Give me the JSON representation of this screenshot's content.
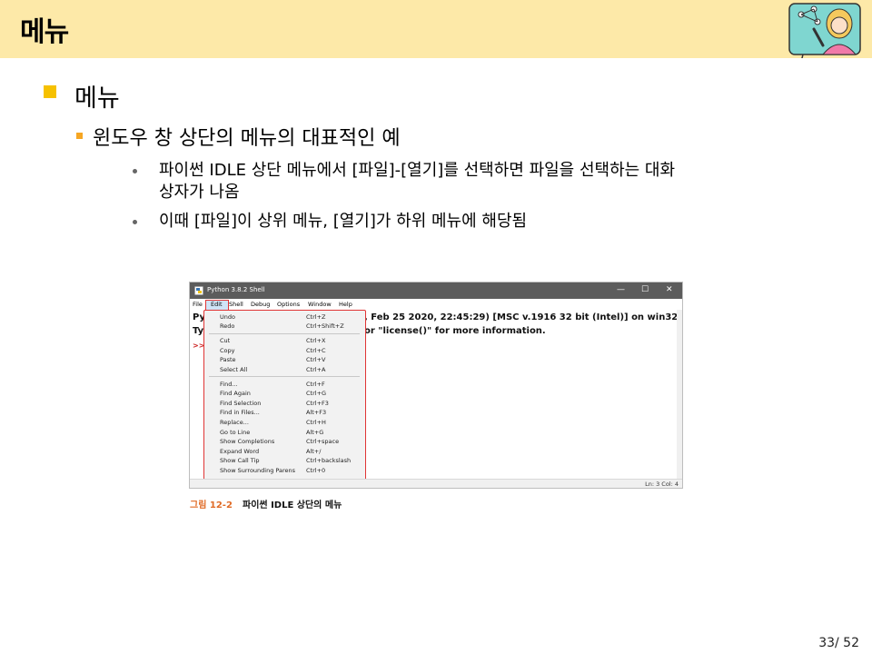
{
  "slide": {
    "title": "메뉴",
    "heading": "메뉴",
    "subheading": "윈도우 창 상단의 메뉴의 대표적인 예",
    "bullets": [
      {
        "line1": "파이썬 IDLE 상단 메뉴에서 [파일]-[열기]를 선택하면 파일을 선택하는 대화",
        "line2": "상자가 나옴"
      },
      {
        "line1": "이때 [파일]이 상위 메뉴, [열기]가 하위 메뉴에 해당됨"
      }
    ],
    "caption_number": "그림 12-2",
    "caption_text": "파이썬 IDLE 상단의 메뉴",
    "page": "33/ 52"
  },
  "window": {
    "title": "Python 3.8.2 Shell",
    "controls": {
      "minimize": "—",
      "maximize": "☐",
      "close": "✕"
    },
    "menubar": [
      "File",
      "Edit",
      "Shell",
      "Debug",
      "Options",
      "Window",
      "Help"
    ],
    "shell_line1_start": "Pyt",
    "shell_line1_end": ", Feb 25 2020, 22:45:29) [MSC v.1916 32 bit (Intel)] on win32",
    "shell_line2_start": "Typ",
    "shell_line2_end": "or \"license()\" for more information.",
    "prompt": ">>",
    "status": "Ln: 3  Col: 4",
    "edit_menu": [
      {
        "label": "Undo",
        "shortcut": "Ctrl+Z"
      },
      {
        "label": "Redo",
        "shortcut": "Ctrl+Shift+Z"
      },
      {
        "label": "Cut",
        "shortcut": "Ctrl+X"
      },
      {
        "label": "Copy",
        "shortcut": "Ctrl+C"
      },
      {
        "label": "Paste",
        "shortcut": "Ctrl+V"
      },
      {
        "label": "Select All",
        "shortcut": "Ctrl+A"
      },
      {
        "label": "Find...",
        "shortcut": "Ctrl+F"
      },
      {
        "label": "Find Again",
        "shortcut": "Ctrl+G"
      },
      {
        "label": "Find Selection",
        "shortcut": "Ctrl+F3"
      },
      {
        "label": "Find in Files...",
        "shortcut": "Alt+F3"
      },
      {
        "label": "Replace...",
        "shortcut": "Ctrl+H"
      },
      {
        "label": "Go to Line",
        "shortcut": "Alt+G"
      },
      {
        "label": "Show Completions",
        "shortcut": "Ctrl+space"
      },
      {
        "label": "Expand Word",
        "shortcut": "Alt+/"
      },
      {
        "label": "Show Call Tip",
        "shortcut": "Ctrl+backslash"
      },
      {
        "label": "Show Surrounding Parens",
        "shortcut": "Ctrl+0"
      }
    ]
  }
}
